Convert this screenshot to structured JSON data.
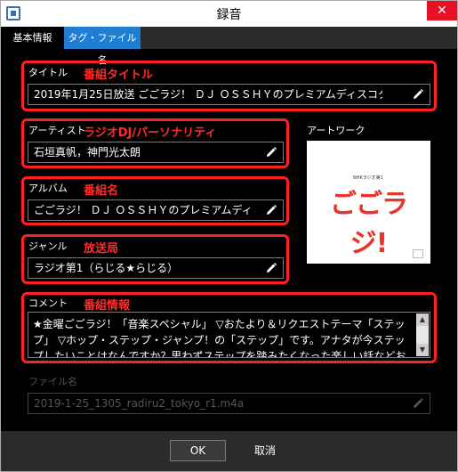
{
  "window": {
    "title": "録音",
    "close_glyph": "✕"
  },
  "tabs": [
    {
      "label": "基本情報",
      "active": true
    },
    {
      "label": "タグ・ファイル名",
      "active": false
    }
  ],
  "fields": {
    "title": {
      "label": "タイトル",
      "value": "2019年1月25日放送 ごごラジ！ ＤＪ ＯＳＳＨＹのプレミアムディスコタイム",
      "annotation": "番組タイトル"
    },
    "artist": {
      "label": "アーティスト",
      "value": "石垣真帆，神門光太朗",
      "annotation": "ラジオDJ/パーソナリティ"
    },
    "album": {
      "label": "アルバム",
      "value": "ごごラジ！ ＤＪ ＯＳＳＨＹのプレミアムディスコ",
      "annotation": "番組名"
    },
    "genre": {
      "label": "ジャンル",
      "value": "ラジオ第1（らじる★らじる）",
      "annotation": "放送局"
    },
    "comment": {
      "label": "コメント",
      "value": "★金曜ごごラジ！「音楽スペシャル」 ▽おたより＆リクエストテーマ「ステップ」 ▽ホップ・ステップ・ジャンプ！の「ステップ」です。アナタが今ステップしたいことはなんですか？思わずステップを踏みたくなった楽しい話などお寄せください。一言でも歓迎です！",
      "annotation": "番組情報"
    },
    "filename": {
      "label": "ファイル名",
      "value": "2019-1-25_1305_radiru2_tokyo_r1.m4a"
    }
  },
  "artwork": {
    "label": "アートワーク",
    "logo_text": "ごごラジ!",
    "logo_sub": "NHKラジオ第1"
  },
  "buttons": {
    "ok": "OK",
    "cancel": "取消"
  },
  "icons": {
    "edit": "pencil-icon",
    "image": "image-icon"
  },
  "colors": {
    "accent_tab": "#1e7ed6",
    "annotation_red": "#ff2020",
    "background": "#000000"
  }
}
